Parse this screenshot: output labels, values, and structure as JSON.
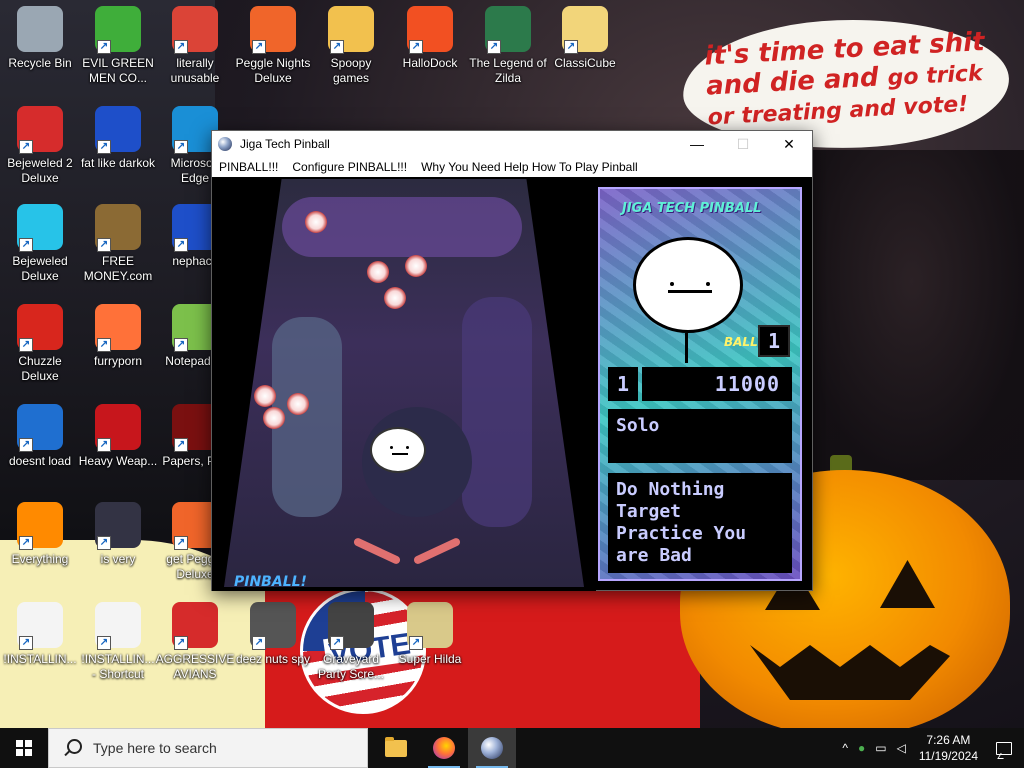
{
  "wallpaper": {
    "speech_line1": "it's time to eat shit",
    "speech_line2": "and die and",
    "speech_line2b": "go trick",
    "speech_line3": "or treating and vote!",
    "badge_text": "VOTE"
  },
  "desktop_icons": [
    {
      "label": "Recycle Bin",
      "icon": "recycle-bin-icon",
      "color": "#9aa7b3"
    },
    {
      "label": "EVIL GREEN MEN CO...",
      "icon": "messenger-icon",
      "color": "#3fae3a"
    },
    {
      "label": "literally unusable",
      "icon": "chrome-icon",
      "color": "#db4437"
    },
    {
      "label": "Peggle Nights Deluxe",
      "icon": "peggle-icon",
      "color": "#f0652a"
    },
    {
      "label": "Spoopy games",
      "icon": "folder-icon",
      "color": "#f2c14e"
    },
    {
      "label": "HalloDock",
      "icon": "windows-logo-icon",
      "color": "#f25022"
    },
    {
      "label": "The Legend of Zilda",
      "icon": "zilda-icon",
      "color": "#2c7a4b"
    },
    {
      "label": "ClassiCube",
      "icon": "folder-icon",
      "color": "#f2d57a"
    },
    {
      "label": "Bejeweled 2 Deluxe",
      "icon": "bejeweled2-icon",
      "color": "#d62c2c"
    },
    {
      "label": "fat like darkok",
      "icon": "mpl-icon",
      "color": "#1e4fc9"
    },
    {
      "label": "Microsoft Edge",
      "icon": "edge-icon",
      "color": "#1a8fd6"
    },
    {
      "label": "Bejeweled Deluxe",
      "icon": "gem-icon",
      "color": "#27c3e8"
    },
    {
      "label": "FREE MONEY.com",
      "icon": "money-bag-icon",
      "color": "#8b6a34"
    },
    {
      "label": "nephack",
      "icon": "mpl-icon",
      "color": "#1e4fc9"
    },
    {
      "label": "Chuzzle Deluxe",
      "icon": "chuzzle-icon",
      "color": "#d8261d"
    },
    {
      "label": "furryporn",
      "icon": "firefox-icon",
      "color": "#ff7139"
    },
    {
      "label": "Notepad++",
      "icon": "notepad-icon",
      "color": "#7cc04b"
    },
    {
      "label": "doesnt load",
      "icon": "thunderbird-icon",
      "color": "#1f6fd0"
    },
    {
      "label": "Heavy Weap...",
      "icon": "radiation-icon",
      "color": "#c7161c"
    },
    {
      "label": "Papers, Pl...",
      "icon": "papers-please-icon",
      "color": "#7a1010"
    },
    {
      "label": "Everything",
      "icon": "search-everything-icon",
      "color": "#ff8a00"
    },
    {
      "label": "is very",
      "icon": "mpl-icon",
      "color": "#334"
    },
    {
      "label": "get Peggle Deluxe",
      "icon": "peggle-icon",
      "color": "#f0652a"
    },
    {
      "label": "!INSTALLIN...",
      "icon": "text-file-icon",
      "color": "#f4f4f4"
    },
    {
      "label": "!INSTALLIN... - Shortcut",
      "icon": "text-file-icon",
      "color": "#f4f4f4"
    },
    {
      "label": "AGGRESSIVE AVIANS",
      "icon": "angry-bird-icon",
      "color": "#d62b2b"
    },
    {
      "label": "deez nuts spy",
      "icon": "windows-stack-icon",
      "color": "#555"
    },
    {
      "label": "Graveyard Party Scre...",
      "icon": "graveyard-icon",
      "color": "#444"
    },
    {
      "label": "Super Hilda",
      "icon": "hilda-icon",
      "color": "#d9c98a"
    }
  ],
  "pinball_window": {
    "title": "Jiga Tech Pinball",
    "menu": [
      "PINBALL!!!",
      "Configure PINBALL!!!",
      "Why You Need Help How To Play Pinball"
    ],
    "minimize": "—",
    "maximize": "☐",
    "close": "✕",
    "playfield_logo": "PINBALL!",
    "panel": {
      "title": "JIGA TECH PINBALL",
      "ball_label": "BALL",
      "ball_number": "1",
      "player": "1",
      "score": "11000",
      "mode": "Solo",
      "mission": "Do Nothing\nTarget\nPractice You\nare Bad"
    }
  },
  "taskbar": {
    "search_placeholder": "Type here to search",
    "time": "7:26 AM",
    "date": "11/19/2024",
    "apps": [
      "file-explorer-icon",
      "firefox-icon",
      "pinball-icon"
    ]
  }
}
